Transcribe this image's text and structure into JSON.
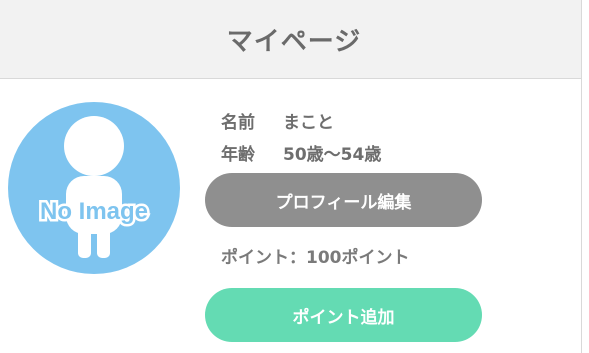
{
  "header": {
    "title": "マイページ"
  },
  "profile": {
    "avatar_text": "No Image",
    "name_label": "名前",
    "name_value": "まこと",
    "age_label": "年齢",
    "age_value": "50歳〜54歳",
    "edit_button_label": "プロフィール編集",
    "points_text": "ポイント：100ポイント",
    "add_points_button_label": "ポイント追加"
  },
  "colors": {
    "avatar_bg": "#7ec4ef",
    "edit_button": "#8f8f8f",
    "add_button": "#64dbb3",
    "header_bg": "#f2f2f2"
  }
}
